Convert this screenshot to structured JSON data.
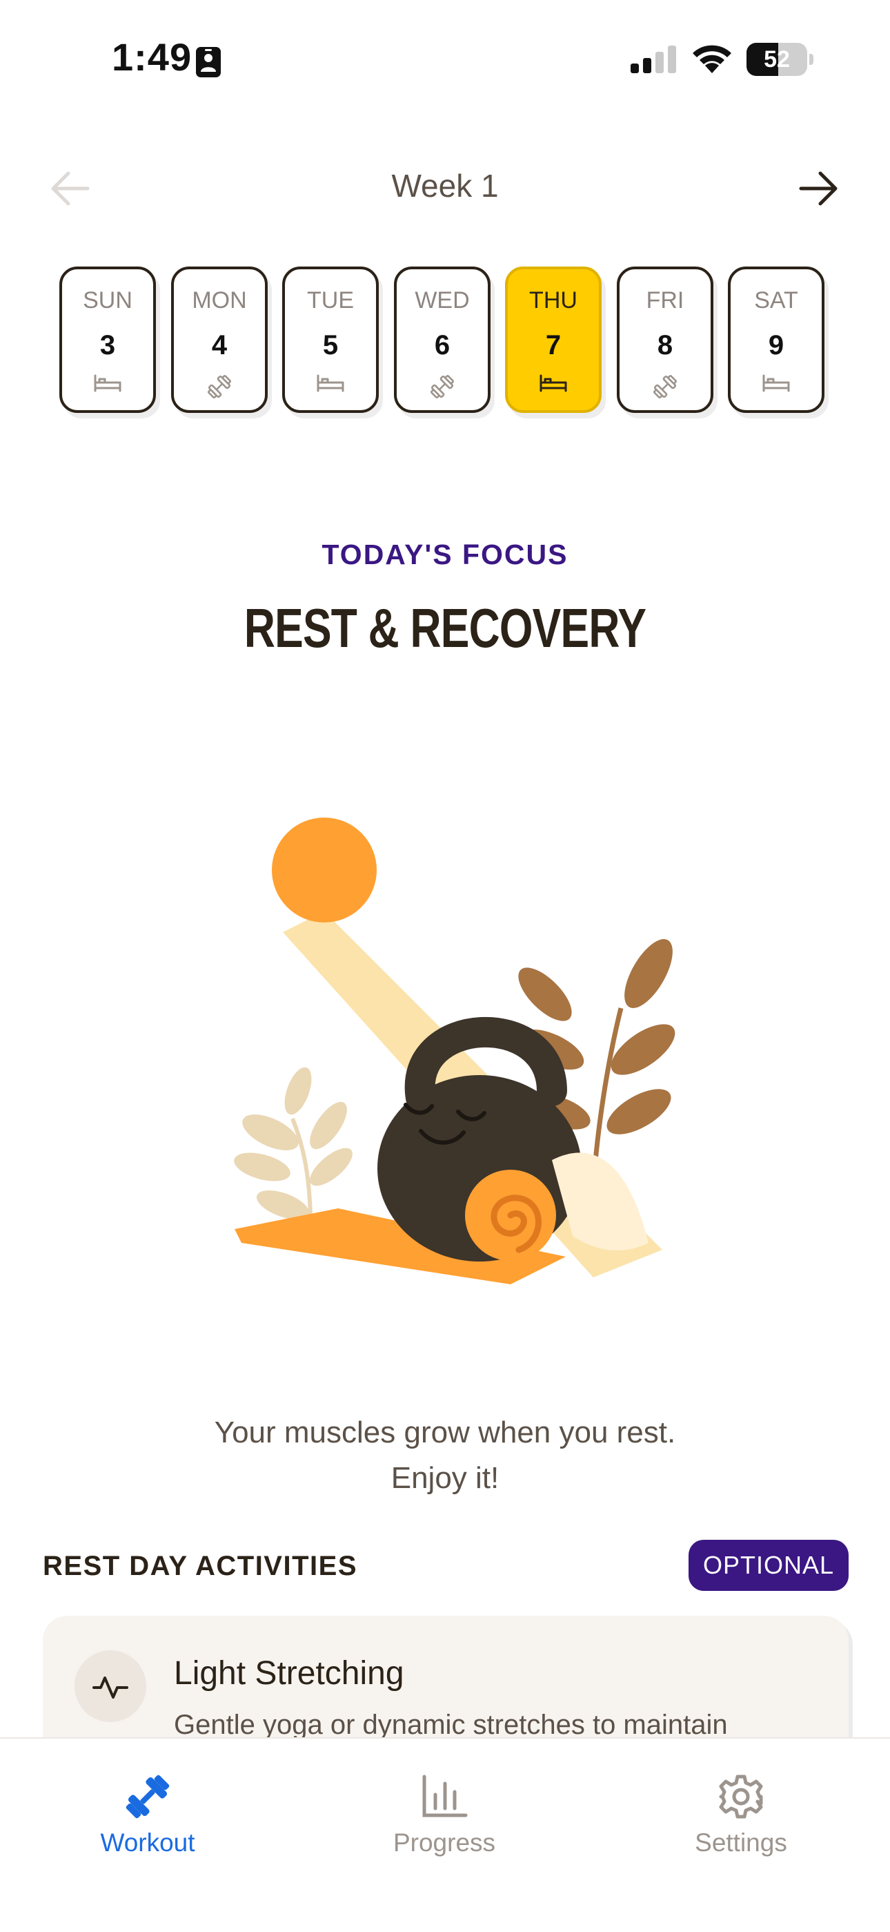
{
  "status_bar": {
    "time": "1:49",
    "battery": 52,
    "icons": [
      "id-card-icon",
      "signal-icon",
      "wifi-icon",
      "battery-icon"
    ]
  },
  "week": {
    "title": "Week 1",
    "prev_icon": "arrow-left-icon",
    "next_icon": "arrow-right-icon"
  },
  "days": [
    {
      "name": "SUN",
      "num": "3",
      "type": "rest",
      "icon": "bed-icon",
      "selected": false
    },
    {
      "name": "MON",
      "num": "4",
      "type": "workout",
      "icon": "dumbbell-icon",
      "selected": false
    },
    {
      "name": "TUE",
      "num": "5",
      "type": "rest",
      "icon": "bed-icon",
      "selected": false
    },
    {
      "name": "WED",
      "num": "6",
      "type": "workout",
      "icon": "dumbbell-icon",
      "selected": false
    },
    {
      "name": "THU",
      "num": "7",
      "type": "rest",
      "icon": "bed-icon",
      "selected": true
    },
    {
      "name": "FRI",
      "num": "8",
      "type": "workout",
      "icon": "dumbbell-icon",
      "selected": false
    },
    {
      "name": "SAT",
      "num": "9",
      "type": "rest",
      "icon": "bed-icon",
      "selected": false
    }
  ],
  "focus": {
    "kicker": "TODAY'S FOCUS",
    "title": "REST & RECOVERY"
  },
  "message": {
    "line1": "Your muscles grow when you rest.",
    "line2": "Enjoy it!"
  },
  "activities": {
    "title": "REST DAY ACTIVITIES",
    "badge": "OPTIONAL",
    "items": [
      {
        "title": "Light Stretching",
        "description": "Gentle yoga or dynamic stretches to maintain",
        "icon": "activity-pulse-icon"
      }
    ]
  },
  "tabs": [
    {
      "label": "Workout",
      "icon": "dumbbell-icon",
      "active": true
    },
    {
      "label": "Progress",
      "icon": "bar-chart-icon",
      "active": false
    },
    {
      "label": "Settings",
      "icon": "gear-icon",
      "active": false
    }
  ],
  "colors": {
    "accent_yellow": "#ffcc00",
    "accent_purple": "#3a1783",
    "active_tab_blue": "#1a6be0",
    "text_dark": "#2b2218",
    "sun_orange": "#ffa032"
  }
}
